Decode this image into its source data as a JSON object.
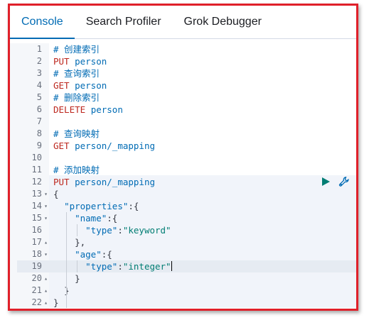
{
  "tabs": [
    {
      "label": "Console",
      "active": true
    },
    {
      "label": "Search Profiler",
      "active": false
    },
    {
      "label": "Grok Debugger",
      "active": false
    }
  ],
  "lines": [
    {
      "n": "1",
      "fold": "",
      "indent": "",
      "parts": [
        [
          "k-comment",
          "# 创建索引"
        ]
      ]
    },
    {
      "n": "2",
      "fold": "",
      "indent": "",
      "parts": [
        [
          "k-method",
          "PUT "
        ],
        [
          "k-url",
          "person"
        ]
      ]
    },
    {
      "n": "3",
      "fold": "",
      "indent": "",
      "parts": [
        [
          "k-comment",
          "# 查询索引"
        ]
      ]
    },
    {
      "n": "4",
      "fold": "",
      "indent": "",
      "parts": [
        [
          "k-method",
          "GET "
        ],
        [
          "k-url",
          "person"
        ]
      ]
    },
    {
      "n": "5",
      "fold": "",
      "indent": "",
      "parts": [
        [
          "k-comment",
          "# 删除索引"
        ]
      ]
    },
    {
      "n": "6",
      "fold": "",
      "indent": "",
      "parts": [
        [
          "k-method",
          "DELETE "
        ],
        [
          "k-url",
          "person"
        ]
      ]
    },
    {
      "n": "7",
      "fold": "",
      "indent": "",
      "parts": []
    },
    {
      "n": "8",
      "fold": "",
      "indent": "",
      "parts": [
        [
          "k-comment",
          "# 查询映射"
        ]
      ]
    },
    {
      "n": "9",
      "fold": "",
      "indent": "",
      "parts": [
        [
          "k-method",
          "GET "
        ],
        [
          "k-url",
          "person/_mapping"
        ]
      ]
    },
    {
      "n": "10",
      "fold": "",
      "indent": "",
      "parts": []
    },
    {
      "n": "11",
      "fold": "",
      "indent": "",
      "parts": [
        [
          "k-comment",
          "# 添加映射"
        ]
      ]
    },
    {
      "n": "12",
      "fold": "",
      "indent": "",
      "parts": [
        [
          "k-method",
          "PUT "
        ],
        [
          "k-url",
          "person/_mapping"
        ]
      ]
    },
    {
      "n": "13",
      "fold": "▾",
      "indent": "",
      "parts": [
        [
          "k-punc",
          "{"
        ]
      ]
    },
    {
      "n": "14",
      "fold": "▾",
      "indent": "  ",
      "parts": [
        [
          "k-key",
          "\"properties\""
        ],
        [
          "k-punc",
          ":{"
        ]
      ]
    },
    {
      "n": "15",
      "fold": "▾",
      "indent": "    ",
      "parts": [
        [
          "k-key",
          "\"name\""
        ],
        [
          "k-punc",
          ":{"
        ]
      ]
    },
    {
      "n": "16",
      "fold": "",
      "indent": "      ",
      "parts": [
        [
          "k-key",
          "\"type\""
        ],
        [
          "k-punc",
          ":"
        ],
        [
          "k-str",
          "\"keyword\""
        ]
      ]
    },
    {
      "n": "17",
      "fold": "▴",
      "indent": "    ",
      "parts": [
        [
          "k-punc",
          "},"
        ]
      ]
    },
    {
      "n": "18",
      "fold": "▾",
      "indent": "    ",
      "parts": [
        [
          "k-key",
          "\"age\""
        ],
        [
          "k-punc",
          ":{"
        ]
      ]
    },
    {
      "n": "19",
      "fold": "",
      "indent": "      ",
      "parts": [
        [
          "k-key",
          "\"type\""
        ],
        [
          "k-punc",
          ":"
        ],
        [
          "k-str",
          "\"integer\""
        ]
      ],
      "cursor": true
    },
    {
      "n": "20",
      "fold": "▴",
      "indent": "    ",
      "parts": [
        [
          "k-punc",
          "}"
        ]
      ]
    },
    {
      "n": "21",
      "fold": "▴",
      "indent": "  ",
      "parts": [
        [
          "k-punc",
          "}"
        ]
      ]
    },
    {
      "n": "22",
      "fold": "▴",
      "indent": "",
      "parts": [
        [
          "k-punc",
          "}"
        ]
      ]
    }
  ],
  "actions": {
    "run_icon": "play-icon",
    "settings_icon": "wrench-icon"
  },
  "colors": {
    "border": "#e0202a",
    "accent": "#006bb4",
    "method": "#bd271e",
    "string": "#017d73",
    "run": "#017d73"
  }
}
